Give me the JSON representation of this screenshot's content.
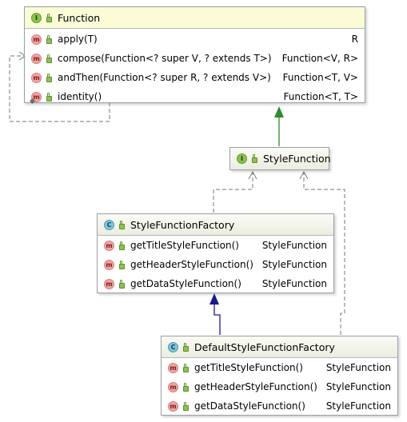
{
  "function_interface": {
    "name": "Function",
    "kind_badge": "I",
    "methods": [
      {
        "name": "apply(T)",
        "returns": "R",
        "icon": "m"
      },
      {
        "name": "compose(Function<? super V, ? extends T>)",
        "returns": "Function<V, R>",
        "icon": "m"
      },
      {
        "name": "andThen(Function<? super R, ? extends V>)",
        "returns": "Function<T, V>",
        "icon": "m"
      },
      {
        "name": "identity()",
        "returns": "Function<T, T>",
        "icon": "m"
      }
    ]
  },
  "style_function_interface": {
    "name": "StyleFunction",
    "kind_badge": "I"
  },
  "style_function_factory_class": {
    "name": "StyleFunctionFactory",
    "kind_badge": "C",
    "methods": [
      {
        "name": "getTitleStyleFunction()",
        "returns": "StyleFunction",
        "icon": "m"
      },
      {
        "name": "getHeaderStyleFunction()",
        "returns": "StyleFunction",
        "icon": "m"
      },
      {
        "name": "getDataStyleFunction()",
        "returns": "StyleFunction",
        "icon": "m"
      }
    ]
  },
  "default_style_function_factory_class": {
    "name": "DefaultStyleFunctionFactory",
    "kind_badge": "C",
    "methods": [
      {
        "name": "getTitleStyleFunction()",
        "returns": "StyleFunction",
        "icon": "m"
      },
      {
        "name": "getHeaderStyleFunction()",
        "returns": "StyleFunction",
        "icon": "m"
      },
      {
        "name": "getDataStyleFunction()",
        "returns": "StyleFunction",
        "icon": "m"
      }
    ]
  },
  "colors": {
    "inheritance_arrow": "#2e8b2e",
    "extends_arrow": "#1a1a8c",
    "dependency_line": "#777777",
    "interface_header": "#fbfbd6"
  }
}
